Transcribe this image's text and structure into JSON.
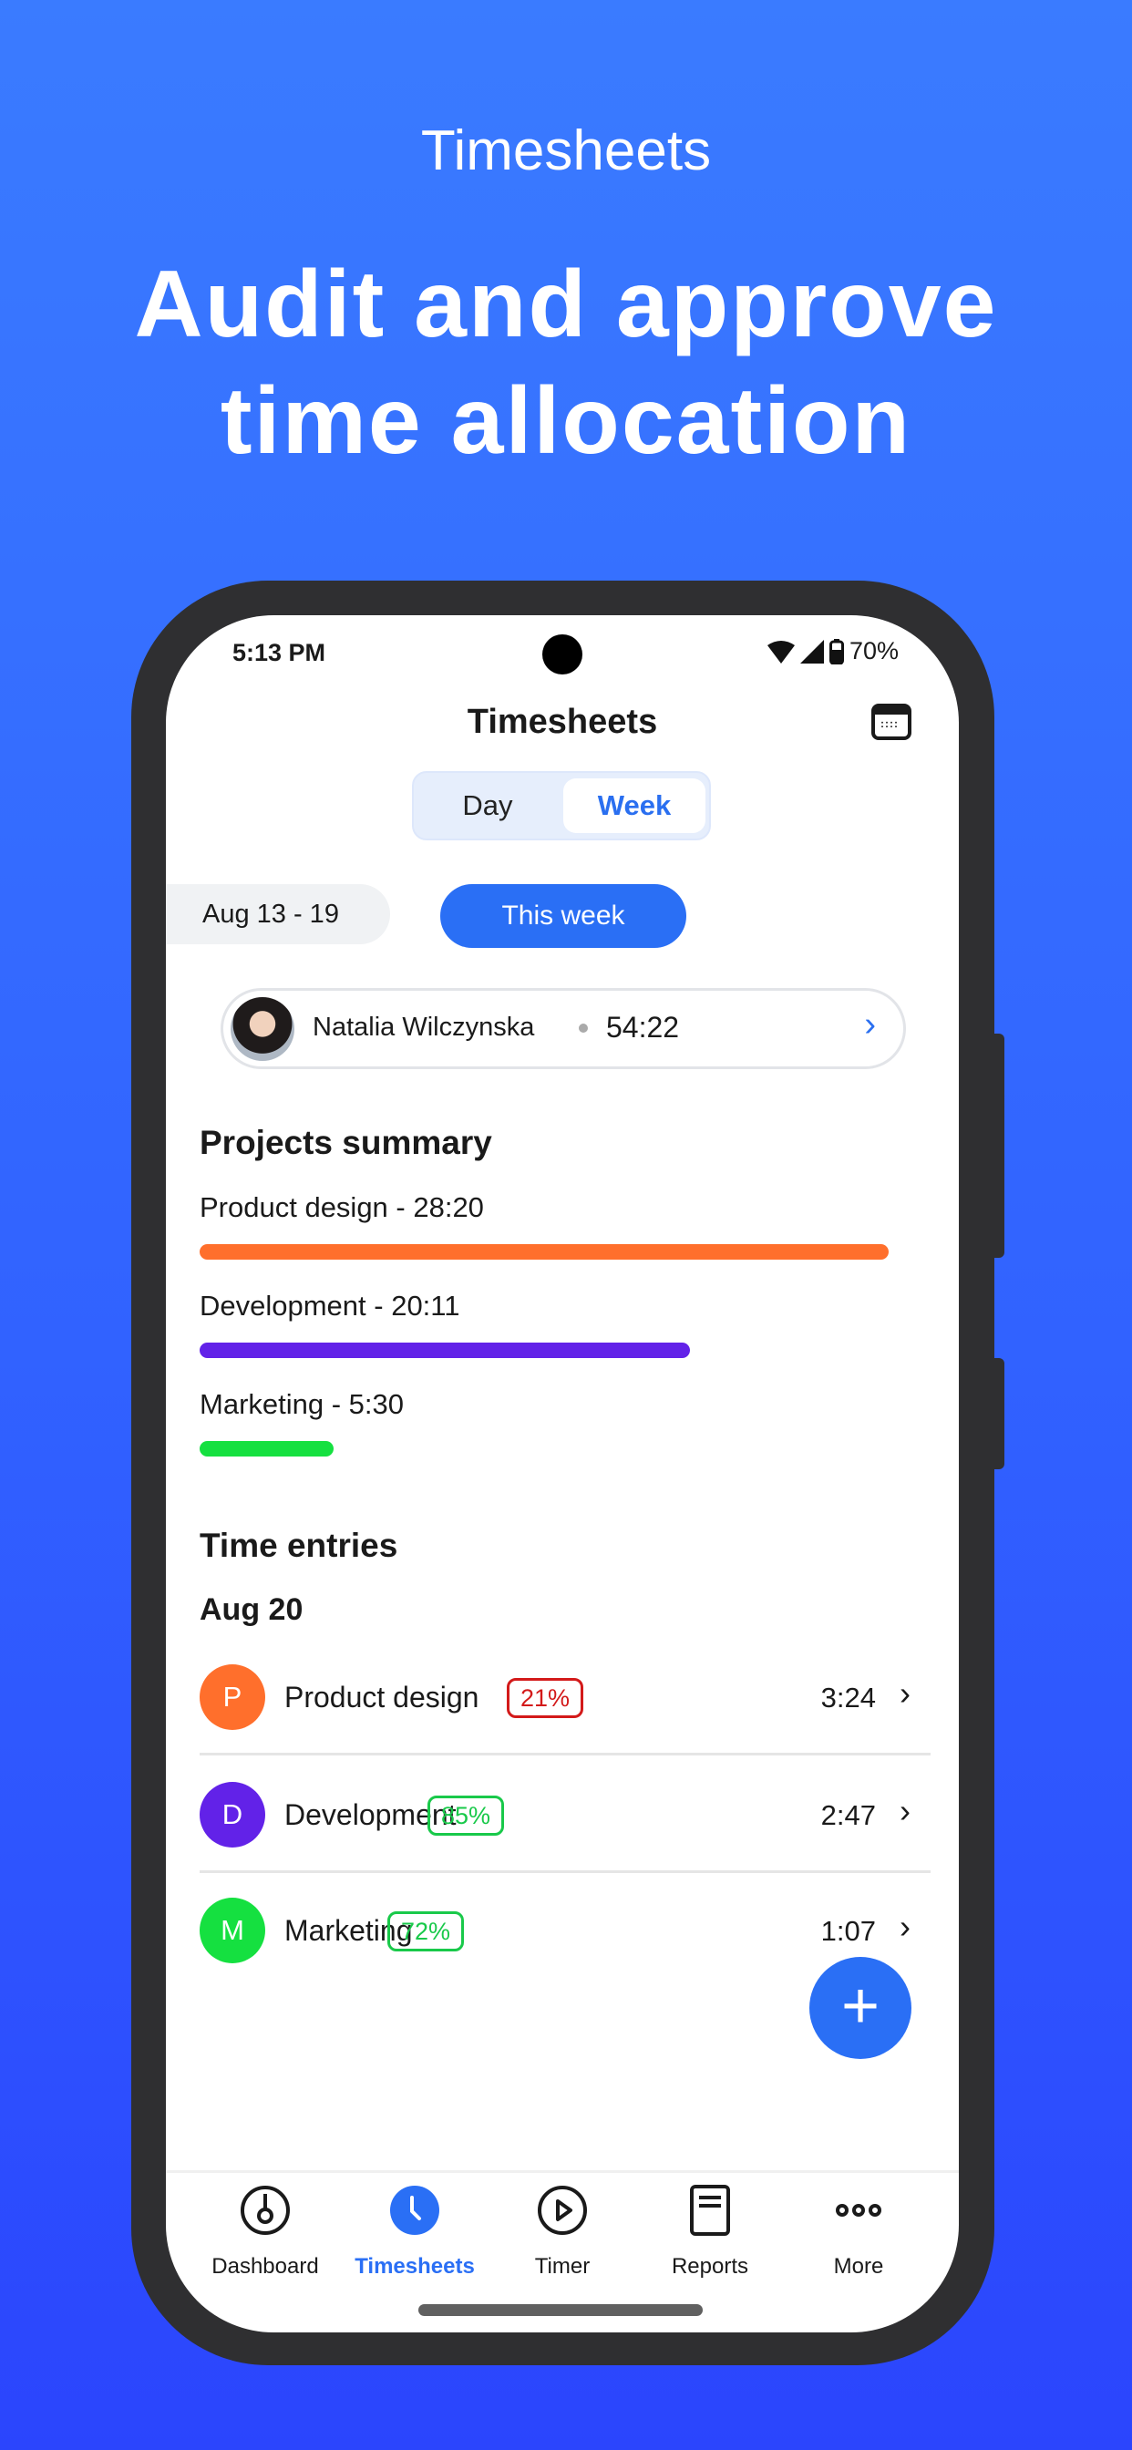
{
  "promo": {
    "subtitle": "Timesheets",
    "headline_line1": "Audit and approve",
    "headline_line2": "time allocation"
  },
  "status_bar": {
    "time": "5:13 PM",
    "battery": "70%"
  },
  "header": {
    "title": "Timesheets",
    "calendar_icon": "calendar-icon"
  },
  "segmented": {
    "options": [
      "Day",
      "Week"
    ],
    "selected": "Week"
  },
  "date_range": {
    "previous": "Aug 13 - 19",
    "current": "This week"
  },
  "user": {
    "name": "Natalia Wilczynska",
    "total": "54:22"
  },
  "projects_summary": {
    "title": "Projects summary",
    "items": [
      {
        "label": "Product design - 28:20",
        "color": "#ff6f2c",
        "fraction": 1.0
      },
      {
        "label": "Development - 20:11",
        "color": "#6222e8",
        "fraction": 0.712
      },
      {
        "label": "Marketing - 5:30",
        "color": "#15e040",
        "fraction": 0.194
      }
    ]
  },
  "time_entries": {
    "title": "Time entries",
    "date": "Aug 20",
    "rows": [
      {
        "initial": "P",
        "name": "Product design",
        "percent": "21%",
        "percent_color": "#d31a1a",
        "color": "#ff6f2c",
        "time": "3:24"
      },
      {
        "initial": "D",
        "name": "Development",
        "percent": "85%",
        "percent_color": "#19c94a",
        "color": "#6222e8",
        "time": "2:47"
      },
      {
        "initial": "M",
        "name": "Marketing",
        "percent": "72%",
        "percent_color": "#19c94a",
        "color": "#15e040",
        "time": "1:07"
      }
    ]
  },
  "fab": {
    "icon": "plus-icon",
    "label": "+"
  },
  "tabs": [
    {
      "label": "Dashboard",
      "icon": "dashboard-gauge-icon"
    },
    {
      "label": "Timesheets",
      "icon": "clock-icon",
      "active": true
    },
    {
      "label": "Timer",
      "icon": "play-icon"
    },
    {
      "label": "Reports",
      "icon": "report-icon"
    },
    {
      "label": "More",
      "icon": "more-dots-icon"
    }
  ],
  "colors": {
    "accent": "#2a6ff5"
  }
}
